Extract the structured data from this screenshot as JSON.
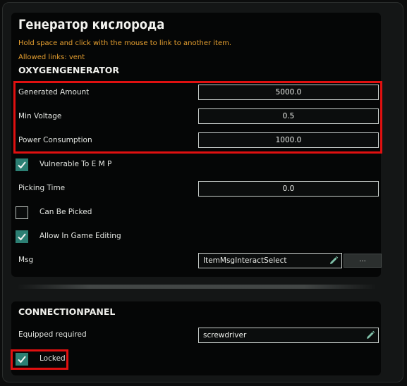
{
  "panel": {
    "title": "Генератор кислорода",
    "hint": "Hold space and click with the mouse to link to another item.",
    "allowed_links": "Allowed links: vent",
    "component_name": "OXYGENGENERATOR"
  },
  "properties": {
    "generated_amount": {
      "label": "Generated Amount",
      "value": "5000.0"
    },
    "min_voltage": {
      "label": "Min Voltage",
      "value": "0.5"
    },
    "power_consumption": {
      "label": "Power Consumption",
      "value": "1000.0"
    },
    "vulnerable_to_emp": {
      "label": "Vulnerable To E M P",
      "checked": true
    },
    "picking_time": {
      "label": "Picking Time",
      "value": "0.0"
    },
    "can_be_picked": {
      "label": "Can Be Picked",
      "checked": false
    },
    "allow_in_game_editing": {
      "label": "Allow In Game Editing",
      "checked": true
    },
    "msg": {
      "label": "Msg",
      "value": "ItemMsgInteractSelect",
      "more_label": "..."
    }
  },
  "connection_panel": {
    "name": "CONNECTIONPANEL",
    "equipped_required": {
      "label": "Equipped required",
      "value": "screwdriver"
    },
    "locked": {
      "label": "Locked",
      "checked": true
    }
  },
  "colors": {
    "accent": "#2c7f73",
    "hint": "#e7a030",
    "highlight": "#e01010"
  },
  "icons": {
    "edit": "pencil-icon",
    "check": "checkmark-icon"
  }
}
